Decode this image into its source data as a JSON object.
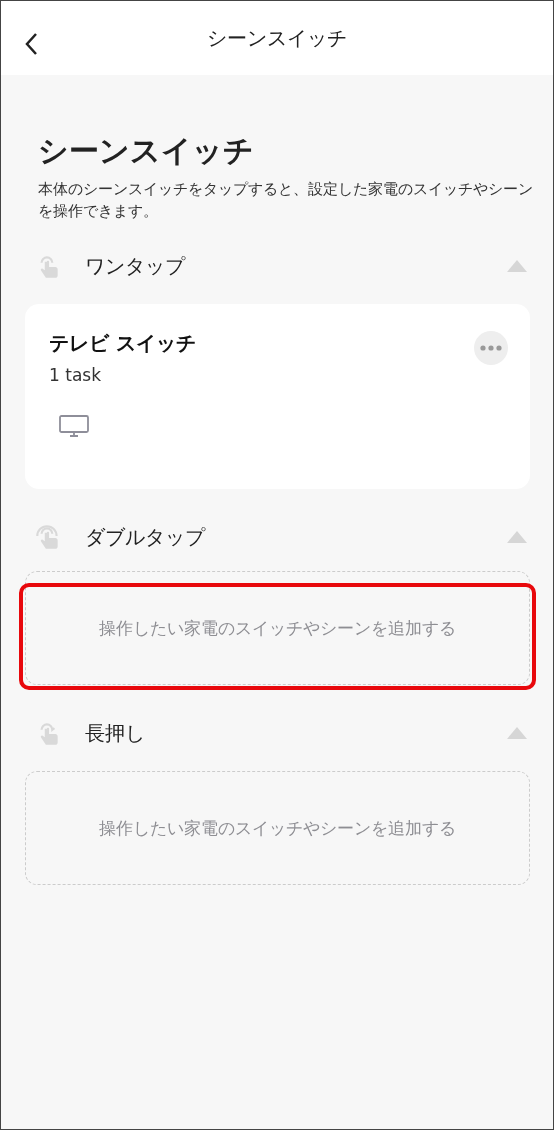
{
  "header": {
    "title": "シーンスイッチ"
  },
  "page": {
    "title": "シーンスイッチ",
    "description": "本体のシーンスイッチをタップすると、設定した家電のスイッチやシーンを操作できます。"
  },
  "sections": [
    {
      "kind": "one-tap",
      "label": "ワンタップ",
      "expanded": true,
      "tasks": [
        {
          "title": "テレビ スイッチ",
          "count": "1 task"
        }
      ]
    },
    {
      "kind": "double-tap",
      "label": "ダブルタップ",
      "expanded": true,
      "add_text": "操作したい家電のスイッチやシーンを追加する",
      "highlighted": true
    },
    {
      "kind": "long-press",
      "label": "長押し",
      "expanded": true,
      "add_text": "操作したい家電のスイッチやシーンを追加する",
      "highlighted": false
    }
  ]
}
